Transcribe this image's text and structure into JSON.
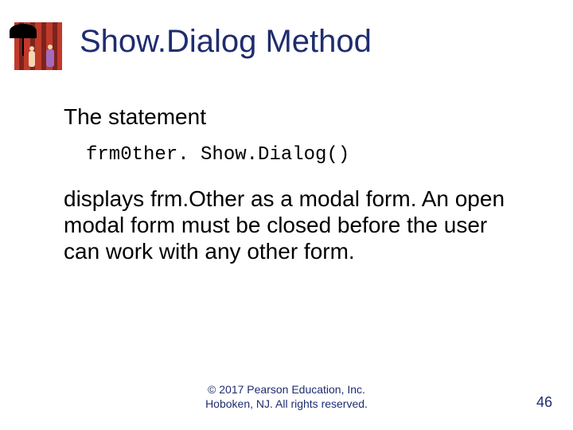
{
  "title": "Show.Dialog Method",
  "body": {
    "lead": "The statement",
    "code": "frm0ther. Show.Dialog()",
    "para": "displays frm.Other as a modal form. An open modal form must be closed before the user can work with any other form."
  },
  "footer": {
    "line1": "© 2017 Pearson Education, Inc.",
    "line2": "Hoboken, NJ. All rights reserved."
  },
  "page_number": "46",
  "icon": {
    "name": "textbook-cover-illustration"
  }
}
